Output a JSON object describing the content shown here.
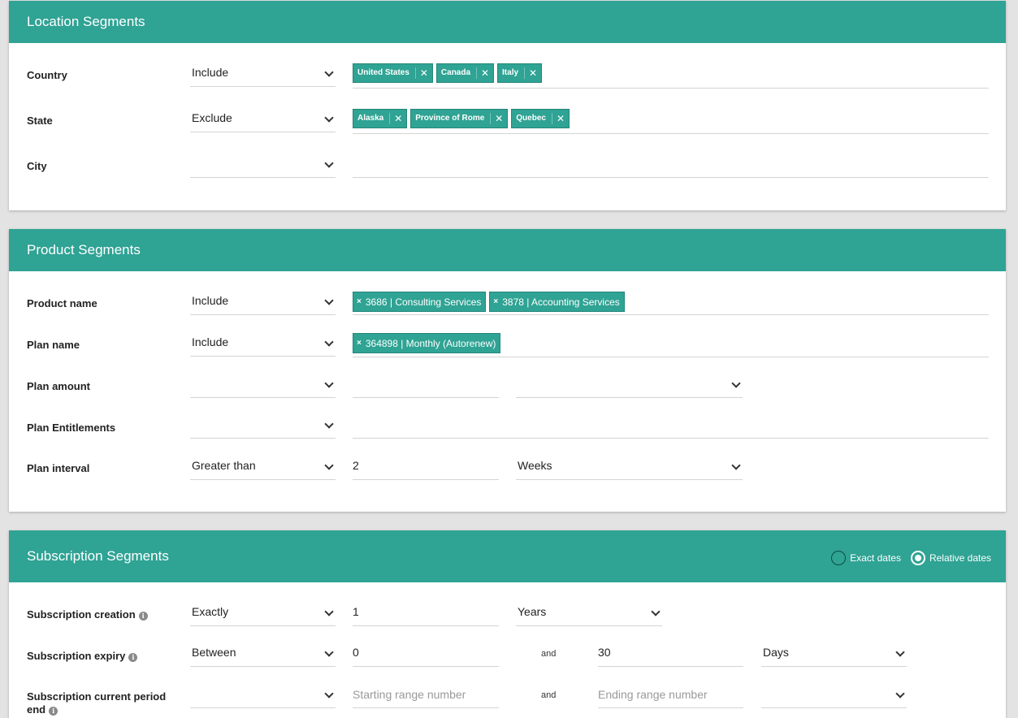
{
  "location": {
    "title": "Location Segments",
    "country": {
      "label": "Country",
      "mode": "Include",
      "tags": [
        "United States",
        "Canada",
        "Italy"
      ]
    },
    "state": {
      "label": "State",
      "mode": "Exclude",
      "tags": [
        "Alaska",
        "Province of Rome",
        "Quebec"
      ]
    },
    "city": {
      "label": "City",
      "mode": ""
    }
  },
  "product": {
    "title": "Product Segments",
    "product_name": {
      "label": "Product name",
      "mode": "Include",
      "tags": [
        "3686 | Consulting Services",
        "3878 | Accounting Services"
      ]
    },
    "plan_name": {
      "label": "Plan name",
      "mode": "Include",
      "tags": [
        "364898 | Monthly (Autorenew)"
      ]
    },
    "plan_amount": {
      "label": "Plan amount",
      "mode": "",
      "value": "",
      "unit": ""
    },
    "plan_entitlements": {
      "label": "Plan Entitlements",
      "mode": ""
    },
    "plan_interval": {
      "label": "Plan interval",
      "mode": "Greater than",
      "value": "2",
      "unit": "Weeks"
    }
  },
  "subscription": {
    "title": "Subscription Segments",
    "radio_exact": "Exact dates",
    "radio_relative": "Relative dates",
    "creation": {
      "label": "Subscription creation",
      "mode": "Exactly",
      "value": "1",
      "unit": "Years"
    },
    "expiry": {
      "label": "Subscription expiry",
      "mode": "Between",
      "from": "0",
      "and": "and",
      "to": "30",
      "unit": "Days"
    },
    "period_end": {
      "label_line1": "Subscription current period",
      "label_line2": "end",
      "mode": "",
      "from_placeholder": "Starting range number",
      "and": "and",
      "to_placeholder": "Ending range number",
      "unit": ""
    }
  }
}
